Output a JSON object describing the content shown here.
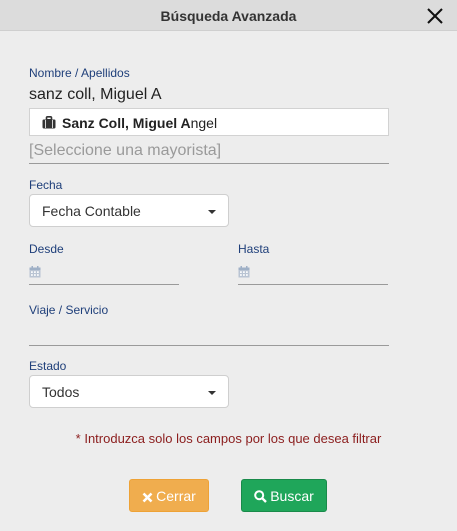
{
  "dialog": {
    "title": "Búsqueda Avanzada",
    "close_icon": "close-icon"
  },
  "name_section": {
    "label": "Nombre / Apellidos",
    "input_value": "sanz coll, Miguel A",
    "suggestion": {
      "icon": "briefcase-icon",
      "match_bold": "Sanz Coll, Miguel A",
      "rest": "ngel"
    },
    "wholesaler_placeholder": "[Seleccione una mayorista]"
  },
  "date_type": {
    "label": "Fecha",
    "selected": "Fecha Contable"
  },
  "range": {
    "from_label": "Desde",
    "to_label": "Hasta",
    "from_value": "",
    "to_value": "",
    "icon": "calendar-icon"
  },
  "trip": {
    "label": "Viaje / Servicio",
    "value": ""
  },
  "status": {
    "label": "Estado",
    "selected": "Todos"
  },
  "note": "* Introduzca solo los campos por los que desea filtrar",
  "buttons": {
    "cancel": {
      "label": "Cerrar",
      "icon": "close-icon",
      "color": "#f0ad4e"
    },
    "search": {
      "label": "Buscar",
      "icon": "search-icon",
      "color": "#1fa65a"
    }
  },
  "colors": {
    "label_text": "#1f3f7a",
    "note_text": "#8b1d1d",
    "background": "#ededed",
    "header": "#dcdcdc"
  }
}
